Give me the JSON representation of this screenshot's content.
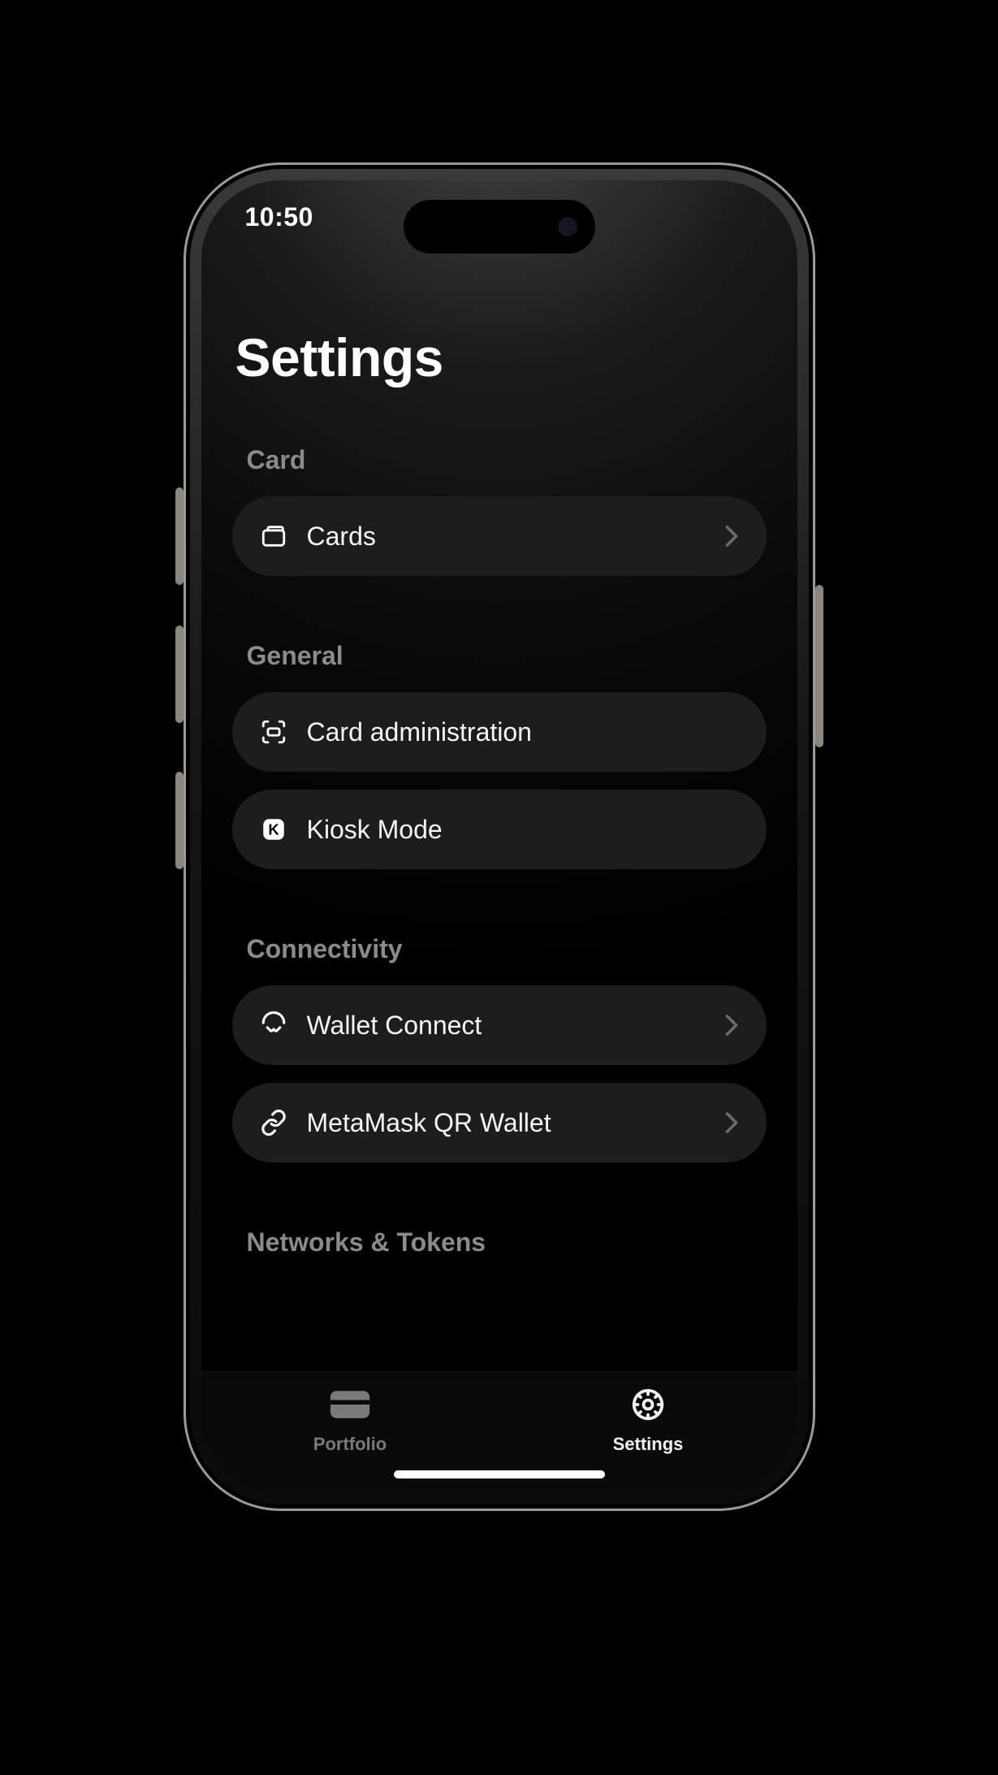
{
  "statusbar": {
    "time": "10:50"
  },
  "page": {
    "title": "Settings"
  },
  "sections": {
    "card": {
      "header": "Card",
      "items": {
        "cards": "Cards"
      }
    },
    "general": {
      "header": "General",
      "items": {
        "card_admin": "Card administration",
        "kiosk": "Kiosk Mode"
      }
    },
    "connectivity": {
      "header": "Connectivity",
      "items": {
        "wallet_connect": "Wallet Connect",
        "metamask": "MetaMask QR Wallet"
      }
    },
    "networks": {
      "header": "Networks & Tokens"
    }
  },
  "tabs": {
    "portfolio": "Portfolio",
    "settings": "Settings"
  }
}
